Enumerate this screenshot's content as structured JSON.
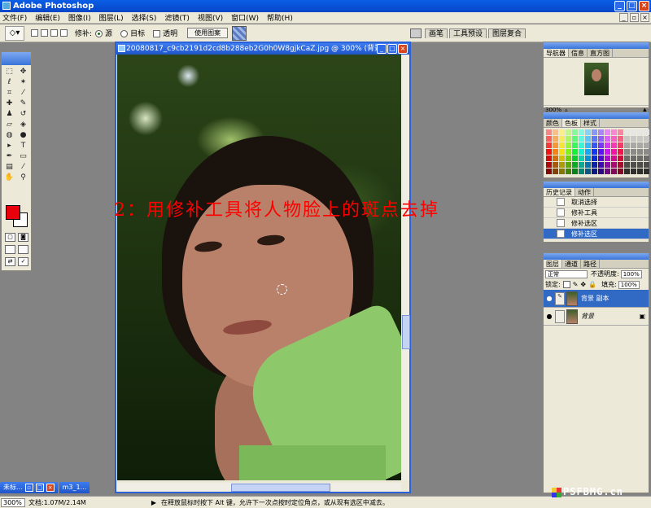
{
  "app": {
    "title": "Adobe Photoshop"
  },
  "menu": [
    "文件(F)",
    "编辑(E)",
    "图像(I)",
    "图层(L)",
    "选择(S)",
    "滤镜(T)",
    "视图(V)",
    "窗口(W)",
    "帮助(H)"
  ],
  "options": {
    "patch_label": "修补:",
    "source_label": "源",
    "target_label": "目标",
    "transparent_label": "透明",
    "use_pattern_button": "使用图案"
  },
  "palette_tabs": [
    "画笔",
    "工具预设",
    "图层复合"
  ],
  "document": {
    "title": "20080817_c9cb2191d2cd8b288eb2G0h0W8gjkCaZ.jpg @ 300% (背景..."
  },
  "overlay_caption": "2：用修补工具将人物脸上的斑点去掉",
  "navigator": {
    "tabs": [
      "导航器",
      "信息",
      "直方图"
    ],
    "zoom": "300%"
  },
  "swatches": {
    "tabs": [
      "颜色",
      "色板",
      "样式"
    ]
  },
  "history": {
    "tabs": [
      "历史记录",
      "动作"
    ],
    "items": [
      {
        "label": "取消选择",
        "selected": false
      },
      {
        "label": "修补工具",
        "selected": false
      },
      {
        "label": "修补选区",
        "selected": false
      },
      {
        "label": "修补选区",
        "selected": true
      }
    ]
  },
  "layers": {
    "tabs": [
      "图层",
      "通道",
      "路径"
    ],
    "blend_mode": "正常",
    "opacity_label": "不透明度:",
    "opacity": "100%",
    "lock_label": "锁定:",
    "fill_label": "填充:",
    "fill": "100%",
    "items": [
      {
        "name": "背景 副本",
        "selected": true
      },
      {
        "name": "背景",
        "selected": false
      }
    ]
  },
  "taskbar_docs": [
    "未标...",
    "m3_1..."
  ],
  "status": {
    "zoom": "300%",
    "doc_size": "文档:1.07M/2.14M",
    "hint": "在释放鼠标时按下 Alt 键，允许下一次点按时定位角点，或从现有选区中减去。"
  },
  "watermark": "PSFBMG.cn",
  "colors": {
    "accent": "#316ac5",
    "title_blue": "#0a5ee6",
    "foreground_swatch": "#e8000a",
    "caption_red": "#ff0000"
  }
}
